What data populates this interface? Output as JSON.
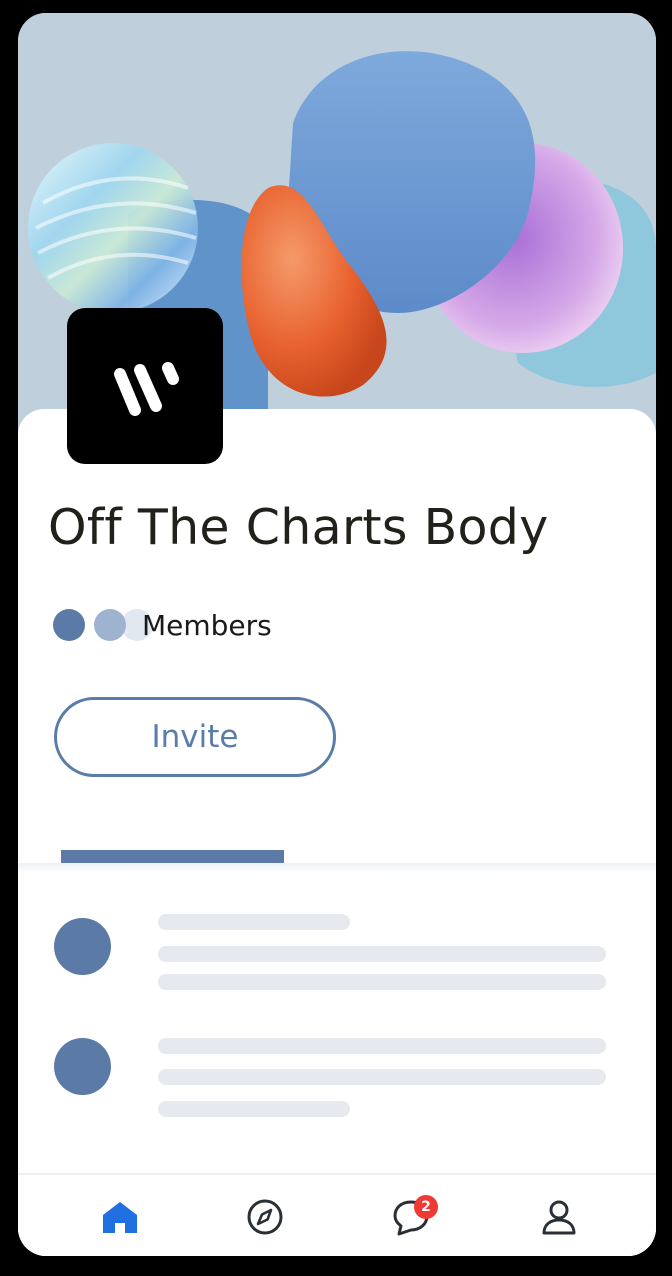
{
  "group": {
    "title": "Off The Charts Body",
    "members_label": "Members",
    "invite_label": "Invite"
  },
  "colors": {
    "accent": "#5b7ba6",
    "hero_background": "#bfcfdc",
    "badge": "#ee3a34",
    "active_nav": "#1f6fe0",
    "skeleton": "#e6eaee"
  },
  "bottom_nav": {
    "items": [
      {
        "icon": "home-icon",
        "active": true
      },
      {
        "icon": "compass-icon",
        "active": false
      },
      {
        "icon": "chat-bubble-icon",
        "active": false,
        "badge": "2"
      },
      {
        "icon": "profile-icon",
        "active": false
      }
    ]
  }
}
